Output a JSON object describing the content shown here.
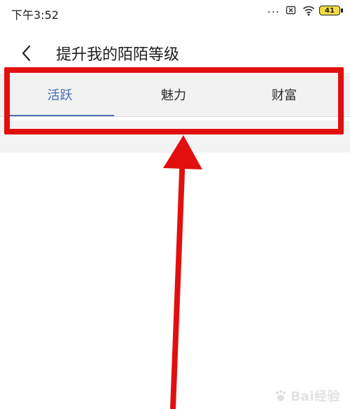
{
  "status_bar": {
    "time": "下午3:52",
    "battery_level": "41",
    "battery_color": "#f5dc43"
  },
  "header": {
    "title": "提升我的陌陌等级",
    "back_icon": "chevron-left-icon"
  },
  "tabs": [
    {
      "label": "活跃",
      "active": true
    },
    {
      "label": "魅力",
      "active": false
    },
    {
      "label": "财富",
      "active": false
    }
  ],
  "colors": {
    "active_tab": "#3f6fb5",
    "annotation": "#e20f0f",
    "tab_background": "#f2f2f2"
  },
  "watermark": {
    "text": "Bai经验"
  }
}
